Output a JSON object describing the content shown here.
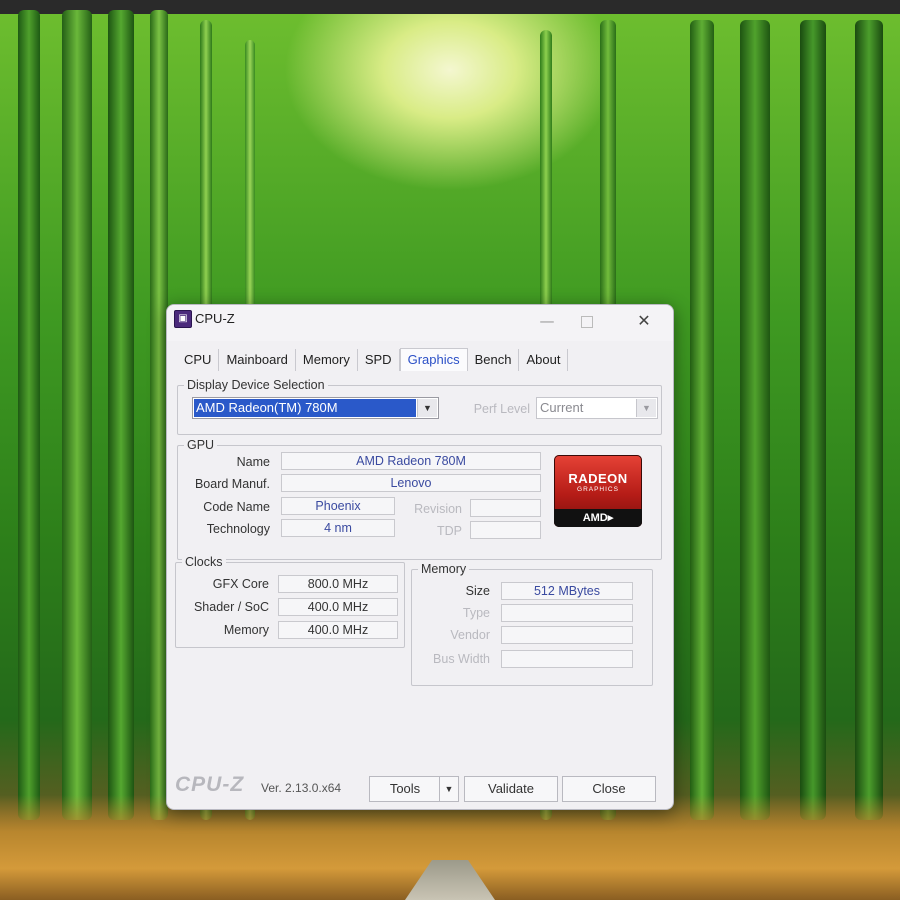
{
  "window": {
    "title": "CPU-Z",
    "icon": "cpu-z-app-icon",
    "minimize": "—",
    "close": "✕"
  },
  "tabs": [
    {
      "label": "CPU"
    },
    {
      "label": "Mainboard"
    },
    {
      "label": "Memory"
    },
    {
      "label": "SPD"
    },
    {
      "label": "Graphics",
      "active": true
    },
    {
      "label": "Bench"
    },
    {
      "label": "About"
    }
  ],
  "display_selection": {
    "title": "Display Device Selection",
    "device": "AMD Radeon(TM) 780M",
    "perf_label": "Perf Level",
    "perf_value": "Current"
  },
  "gpu": {
    "title": "GPU",
    "name_label": "Name",
    "name": "AMD Radeon 780M",
    "board_label": "Board Manuf.",
    "board": "Lenovo",
    "code_label": "Code Name",
    "code": "Phoenix",
    "revision_label": "Revision",
    "revision": "",
    "tech_label": "Technology",
    "tech": "4 nm",
    "tdp_label": "TDP",
    "tdp": "",
    "logo": {
      "line1": "RADEON",
      "line2": "GRAPHICS",
      "line3": "AMD▸"
    }
  },
  "clocks": {
    "title": "Clocks",
    "gfx_label": "GFX Core",
    "gfx": "800.0 MHz",
    "shader_label": "Shader / SoC",
    "shader": "400.0 MHz",
    "memory_label": "Memory",
    "memory": "400.0 MHz"
  },
  "memory": {
    "title": "Memory",
    "size_label": "Size",
    "size": "512 MBytes",
    "type_label": "Type",
    "type": "",
    "vendor_label": "Vendor",
    "vendor": "",
    "bus_label": "Bus Width",
    "bus": ""
  },
  "footer": {
    "logo": "CPU-Z",
    "version": "Ver. 2.13.0.x64",
    "tools": "Tools",
    "validate": "Validate",
    "close": "Close"
  },
  "colors": {
    "accent_tab": "#2b50c7",
    "value_text": "#3a4aa0",
    "selection": "#2a59c9",
    "radeon_red": "#c8261e"
  }
}
